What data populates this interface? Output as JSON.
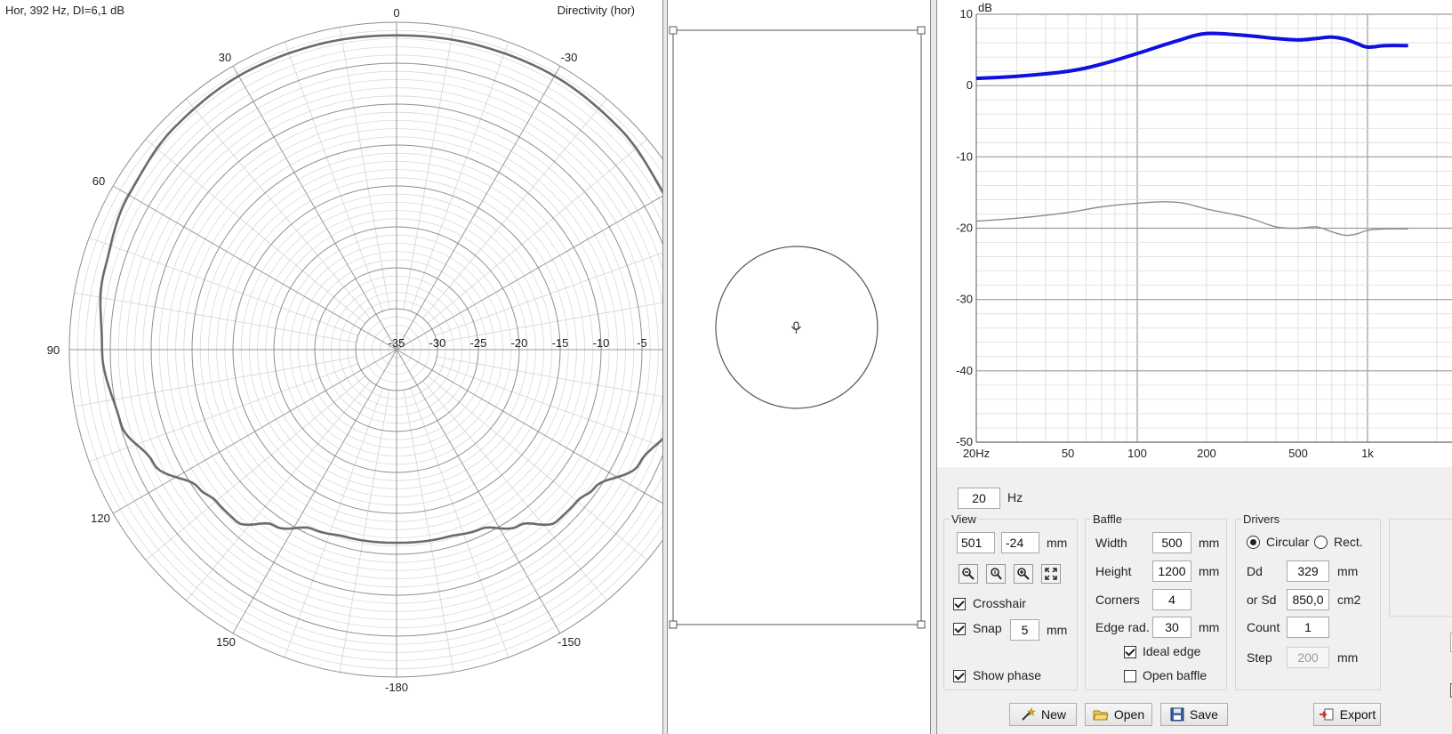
{
  "polar": {
    "info": "Hor, 392 Hz, DI=6,1 dB",
    "title": "Directivity (hor)",
    "angle_labels": [
      "0",
      "-30",
      "30",
      "60",
      "90",
      "120",
      "150",
      "-180",
      "-150"
    ],
    "db_labels": [
      "-35",
      "-30",
      "-25",
      "-20",
      "-15",
      "-10",
      "-5"
    ]
  },
  "chart_data": {
    "type": "line",
    "title": "",
    "x_scale": "log",
    "xlim": [
      20,
      1500
    ],
    "ylim": [
      -50,
      10
    ],
    "y_unit_label": "dB",
    "x_ticks": [
      "20Hz",
      "50",
      "100",
      "200",
      "500",
      "1k"
    ],
    "y_ticks": [
      "10",
      "0",
      "-10",
      "-20",
      "-30",
      "-40",
      "-50"
    ],
    "series": [
      {
        "color": "#1010e0",
        "x": [
          20,
          30,
          50,
          70,
          100,
          150,
          200,
          300,
          400,
          500,
          600,
          700,
          800,
          900,
          1000,
          1200,
          1500
        ],
        "y": [
          1.0,
          1.3,
          2.0,
          3.0,
          4.5,
          6.3,
          7.3,
          7.0,
          6.6,
          6.4,
          6.6,
          6.8,
          6.5,
          5.9,
          5.4,
          5.6,
          5.6
        ]
      },
      {
        "color": "#8c8c8c",
        "x": [
          20,
          30,
          50,
          70,
          100,
          130,
          160,
          200,
          300,
          400,
          500,
          600,
          700,
          800,
          900,
          1000,
          1200,
          1500
        ],
        "y": [
          -19.0,
          -18.6,
          -17.8,
          -17.0,
          -16.5,
          -16.3,
          -16.5,
          -17.3,
          -18.5,
          -19.8,
          -20.0,
          -19.8,
          -20.5,
          -21.0,
          -20.8,
          -20.3,
          -20.1,
          -20.1
        ]
      }
    ]
  },
  "freq": {
    "value": "20",
    "unit": "Hz"
  },
  "view": {
    "title": "View",
    "x": "501",
    "y": "-24",
    "unit": "mm",
    "crosshair_label": "Crosshair",
    "crosshair_checked": true,
    "snap_label": "Snap",
    "snap_value": "5",
    "snap_unit": "mm",
    "snap_checked": true,
    "show_phase_label": "Show phase",
    "show_phase_checked": true
  },
  "baffle": {
    "title": "Baffle",
    "width_label": "Width",
    "width_value": "500",
    "width_unit": "mm",
    "height_label": "Height",
    "height_value": "1200",
    "height_unit": "mm",
    "corners_label": "Corners",
    "corners_value": "4",
    "edge_label": "Edge rad.",
    "edge_value": "30",
    "edge_unit": "mm",
    "ideal_edge_label": "Ideal edge",
    "ideal_edge_checked": true,
    "open_baffle_label": "Open baffle",
    "open_baffle_checked": false
  },
  "drivers": {
    "title": "Drivers",
    "circular_label": "Circular",
    "rect_label": "Rect.",
    "circular_selected": true,
    "dd_label": "Dd",
    "dd_value": "329",
    "dd_unit": "mm",
    "sd_label": "or Sd",
    "sd_value": "850,0",
    "sd_unit": "cm2",
    "count_label": "Count",
    "count_value": "1",
    "step_label": "Step",
    "step_value": "200",
    "step_unit": "mm"
  },
  "buttons": {
    "new": "New",
    "open": "Open",
    "save": "Save",
    "export": "Export"
  }
}
